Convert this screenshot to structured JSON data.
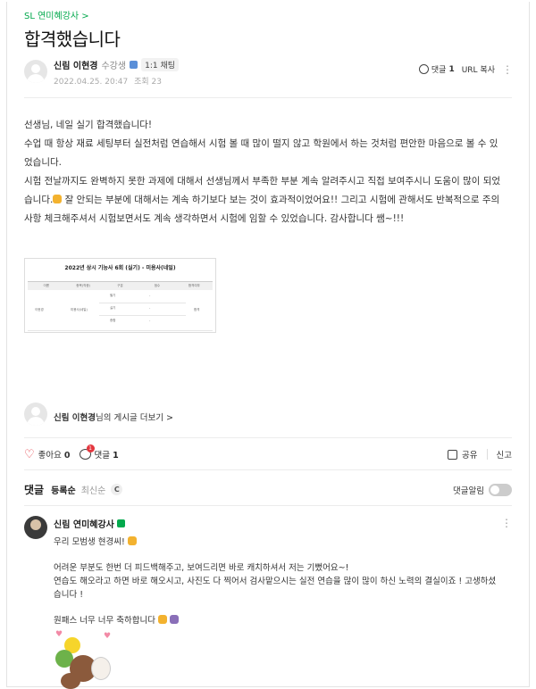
{
  "header": {
    "cafe_link": "SL 연미혜강사 >",
    "title": "합격했습니다"
  },
  "author": {
    "name": "신림 이현경",
    "grade": "수강생",
    "chat_label": "1:1 채팅",
    "date": "2022.04.25. 20:47",
    "views": "조회 23"
  },
  "toolbar": {
    "comment_label": "댓글",
    "comment_count": "1",
    "url_copy": "URL 복사"
  },
  "post": {
    "lines": [
      "선생님, 네일 실기 합격했습니다!",
      "수업 때 항상 재료 세팅부터 실전처럼 연습해서 시험 볼 때 많이 떨지 않고 학원에서 하는 것처럼 편안한 마음으로 볼 수 있었습니다.",
      "시험 전날까지도 완벽하지 못한 과제에 대해서 선생님께서 부족한 부분 계속 알려주시고 직접 보여주시니 도움이 많이 되었습니다.",
      " 잘 안되는 부분에 대해서는 계속 하기보다 보는 것이 효과적이었어요!!  그리고 시험에 관해서도 반복적으로 주의사항 체크해주셔서 시험보면서도 계속 생각하면서 시험에 임할 수 있었습니다. 감사합니다 쌤~!!!"
    ],
    "image_table": {
      "title": "2022년 상시 기능사 6회 (실기) - 미용사(네일)",
      "headers": [
        "이름",
        "종목(직종)",
        "구분",
        "점수",
        "합격여부"
      ],
      "row_name": "이현경",
      "row_subject": "미용사(네일)",
      "row_parts": [
        "필기",
        "실기",
        "종합"
      ],
      "row_scores": [
        "-",
        "-",
        "-"
      ],
      "row_result": "합격"
    }
  },
  "more_posts": {
    "name": "신림 이현경",
    "suffix": "님의 게시글 더보기 >"
  },
  "actions": {
    "like_label": "좋아요",
    "like_count": "0",
    "comment_label": "댓글",
    "comment_count": "1",
    "comment_badge": "1",
    "share_label": "공유",
    "report_label": "신고"
  },
  "comments": {
    "title": "댓글",
    "sort_registered": "등록순",
    "sort_newest": "최신순",
    "refresh_glyph": "C",
    "notify_label": "댓글알림",
    "notify_on": false,
    "items": [
      {
        "author": "신림 연미혜강사",
        "line1": "우리 모범생 현경씨! ",
        "para1_line1": "어려운 부분도 한번 더 피드백해주고, 보여드리면 바로 캐치하셔서 저는 기뻤어요~!",
        "para1_line2": "연습도 해오라고 하면 바로 해오시고, 사진도 다 찍어서 검사맡으시는 실전 연습을 많이 많이 하신 노력의 결실이죠 ! 고생하셨습니다 !",
        "para2": "원패스 너무 너무 축하합니다 "
      }
    ]
  },
  "colors": {
    "brand_green": "#03a94d",
    "like_red": "#e4363e"
  },
  "icons": [
    "comment-icon",
    "more-icon",
    "heart-icon",
    "share-icon",
    "refresh-icon",
    "toggle-switch"
  ]
}
